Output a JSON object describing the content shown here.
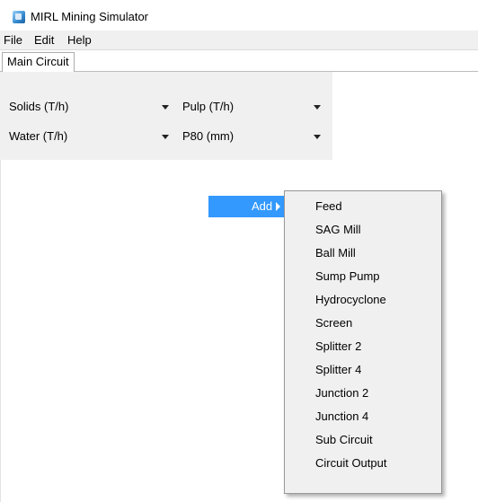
{
  "window": {
    "title": "MIRL Mining Simulator",
    "icon": "app-icon"
  },
  "menu": {
    "items": [
      "File",
      "Edit",
      "Help"
    ]
  },
  "tabs": [
    {
      "label": "Main Circuit",
      "active": true
    }
  ],
  "toolbar": {
    "dropdowns": [
      {
        "label": "Solids (T/h)"
      },
      {
        "label": "Pulp (T/h)"
      },
      {
        "label": "Water (T/h)"
      },
      {
        "label": "P80 (mm)"
      }
    ]
  },
  "context_menu": {
    "add_label": "Add",
    "highlight_color": "#3399ff",
    "submenu": [
      "Feed",
      "SAG Mill",
      "Ball Mill",
      "Sump Pump",
      "Hydrocyclone",
      "Screen",
      "Splitter 2",
      "Splitter 4",
      "Junction 2",
      "Junction 4",
      "Sub Circuit",
      "Circuit Output"
    ]
  }
}
